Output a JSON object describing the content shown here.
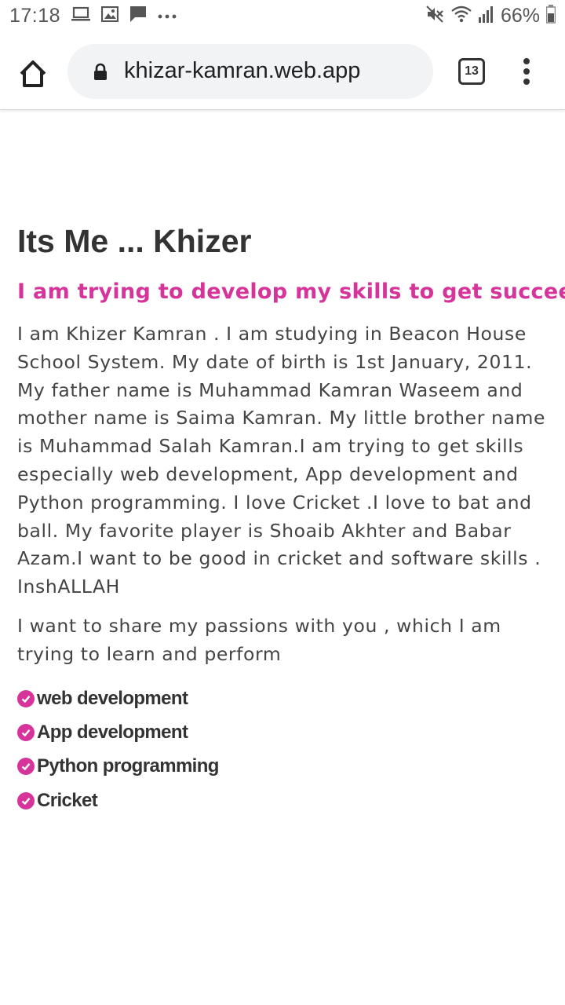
{
  "status_bar": {
    "time": "17:18",
    "battery": "66%",
    "left_icons": [
      "laptop-icon",
      "image-icon",
      "message-icon",
      "more-dots-icon"
    ],
    "right_icons": [
      "mute-icon",
      "wifi-icon",
      "signal-icon",
      "battery-icon"
    ]
  },
  "browser": {
    "url": "khizar-kamran.web.app",
    "tab_count": "13"
  },
  "page": {
    "title": "Its Me ... Khizer",
    "subtitle": "I am trying to develop my skills to get succeed",
    "bio": "I am Khizer Kamran . I am studying in Beacon House School System. My date of birth is 1st January, 2011. My father name is Muhammad Kamran Waseem and mother name is Saima Kamran. My little brother name is Muhammad Salah Kamran.I am trying to get skills especially web development, App development and Python programming. I love Cricket .I love to bat and ball. My favorite player is Shoaib Akhter and Babar Azam.I want to be good in cricket and software skills . InshALLAH",
    "intro": "I want to share my passions with you , which I am trying to learn and perform",
    "skills": [
      "web development",
      "App development",
      "Python programming",
      "Cricket"
    ]
  },
  "colors": {
    "accent": "#d6339b",
    "heading": "#333333",
    "body_text": "#444444",
    "url_bar_bg": "#f1f3f4"
  }
}
